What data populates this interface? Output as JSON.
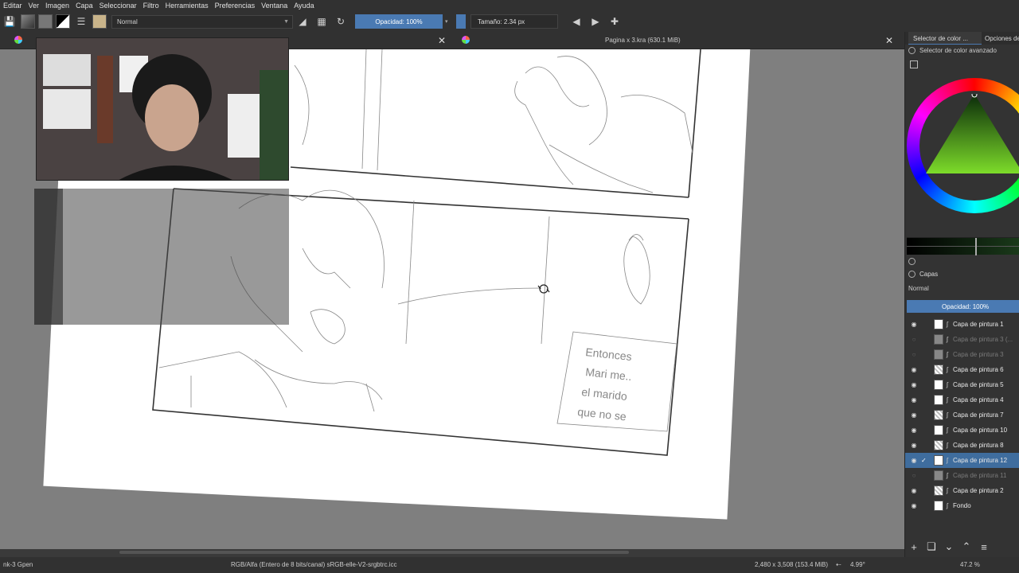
{
  "menu": [
    "Editar",
    "Ver",
    "Imagen",
    "Capa",
    "Seleccionar",
    "Filtro",
    "Herramientas",
    "Preferencias",
    "Ventana",
    "Ayuda"
  ],
  "toolbar": {
    "blend_mode": "Normal",
    "opacity": "Opacidad: 100%",
    "size": "Tamaño: 2.34 px"
  },
  "document": {
    "title": "Pagina x 3.kra (630.1 MiB)",
    "close_glyph": "✕"
  },
  "statusbar": {
    "brush": "nk-3 Gpen",
    "colorspace": "RGB/Alfa (Entero de 8 bits/canal)  sRGB-elle-V2-srgbtrc.icc",
    "dimensions": "2,480 x 3,508 (153.4 MiB)",
    "rotation": "4.99°",
    "zoom": "47.2 %"
  },
  "right_panel": {
    "tabs": [
      "Selector de color ...",
      "Opciones de"
    ],
    "subtitle": "Selector de color avanzado",
    "layers_title": "Capas",
    "layers_blend": "Normal",
    "layers_opacity": "Opacidad:  100%"
  },
  "layers": [
    {
      "name": "Capa de pintura 1",
      "visible": true,
      "selected": false,
      "thumb": "plain"
    },
    {
      "name": "Capa de pintura 3 (...",
      "visible": false,
      "selected": false,
      "thumb": "dim"
    },
    {
      "name": "Capa de pintura 3",
      "visible": false,
      "selected": false,
      "thumb": "dim"
    },
    {
      "name": "Capa de pintura 6",
      "visible": true,
      "selected": false,
      "thumb": "grid"
    },
    {
      "name": "Capa de pintura 5",
      "visible": true,
      "selected": false,
      "thumb": "plain"
    },
    {
      "name": "Capa de pintura 4",
      "visible": true,
      "selected": false,
      "thumb": "plain"
    },
    {
      "name": "Capa de pintura 7",
      "visible": true,
      "selected": false,
      "thumb": "grid"
    },
    {
      "name": "Capa de pintura 10",
      "visible": true,
      "selected": false,
      "thumb": "plain"
    },
    {
      "name": "Capa de pintura 8",
      "visible": true,
      "selected": false,
      "thumb": "grid"
    },
    {
      "name": "Capa de pintura 12",
      "visible": true,
      "selected": true,
      "thumb": "plain"
    },
    {
      "name": "Capa de pintura 11",
      "visible": false,
      "selected": false,
      "thumb": "dim"
    },
    {
      "name": "Capa de pintura 2",
      "visible": true,
      "selected": false,
      "thumb": "grid"
    },
    {
      "name": "Fondo",
      "visible": true,
      "selected": false,
      "thumb": "plain"
    }
  ],
  "canvas_sketch_text": [
    "Entonces",
    "Mari me..",
    "el marido",
    "que no se"
  ],
  "icons": {
    "save": "save-icon",
    "eraser": "eraser-icon",
    "alpha": "alpha-lock-icon",
    "reset": "reload-icon",
    "mirror_h": "mirror-horizontal-icon",
    "mirror_v": "mirror-vertical-icon",
    "crop": "wrap-icon",
    "add": "plus-icon",
    "duplicate": "duplicate-icon",
    "down": "chevron-down-icon",
    "up": "chevron-up-icon",
    "menu": "menu-icon"
  }
}
